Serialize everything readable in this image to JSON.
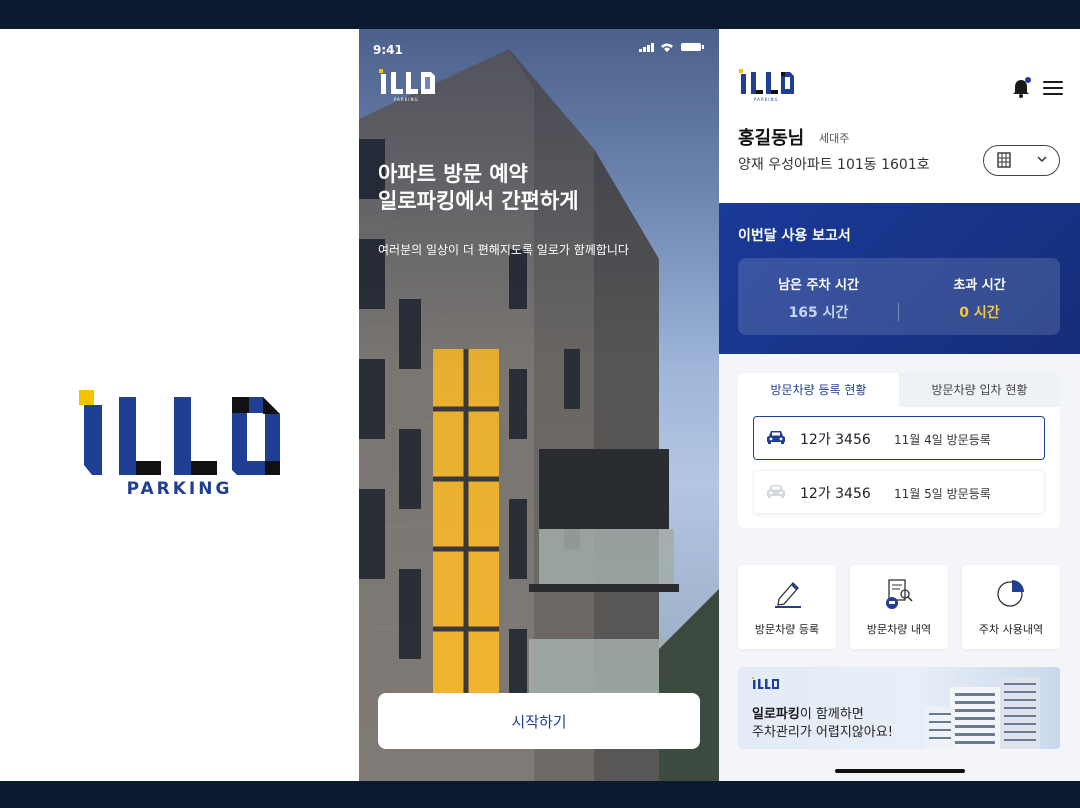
{
  "splash": {
    "logo_text": "ILLO",
    "tagline": "PARKING"
  },
  "onboarding": {
    "status_time": "9:41",
    "logo_text": "ILLO",
    "logo_sub": "PARKING",
    "headline_line1": "아파트 방문 예약",
    "headline_line2": "일로파킹에서 간편하게",
    "subtext": "여러분의 일상이 더 편해지도록 일로가 함께합니다",
    "start_button": "시작하기"
  },
  "dashboard": {
    "logo_text": "ILLO",
    "logo_sub": "PARKING",
    "user": {
      "name": "홍길동님",
      "role": "세대주",
      "address": "양재 우성아파트 101동 1601호"
    },
    "report": {
      "title": "이번달 사용 보고서",
      "remaining_label": "남은 주차 시간",
      "remaining_value": "165 시간",
      "over_label": "초과 시간",
      "over_value": "0 시간"
    },
    "tabs": [
      {
        "label": "방문차량 등록 현황"
      },
      {
        "label": "방문차량 입차 현황"
      }
    ],
    "vehicles": [
      {
        "plate": "12가 3456",
        "date": "11월 4일 방문등록"
      },
      {
        "plate": "12가 3456",
        "date": "11월 5일 방문등록"
      }
    ],
    "menu": [
      {
        "label": "방문차량 등록",
        "icon": "pencil-icon"
      },
      {
        "label": "방문차량 내역",
        "icon": "document-search-icon"
      },
      {
        "label": "주차 사용내역",
        "icon": "pie-chart-icon"
      }
    ],
    "banner": {
      "logo_text": "ILLO",
      "highlight": "일로파킹",
      "line1_rest": "이 함께하면",
      "line2": "주차관리가 어렵지않아요!"
    },
    "colors": {
      "brand_blue": "#1f3f95",
      "accent_yellow": "#f5c73a"
    }
  }
}
